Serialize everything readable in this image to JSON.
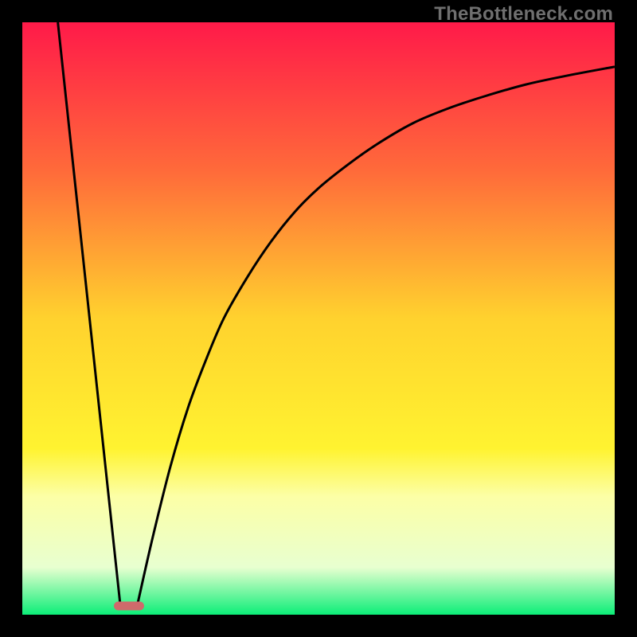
{
  "watermark": {
    "text": "TheBottleneck.com"
  },
  "chart_data": {
    "type": "line",
    "title": "",
    "xlabel": "",
    "ylabel": "",
    "xlim": [
      0,
      100
    ],
    "ylim": [
      0,
      100
    ],
    "gradient_stops": [
      {
        "at": 0,
        "color": "#ff1a49"
      },
      {
        "at": 25,
        "color": "#ff6a3a"
      },
      {
        "at": 50,
        "color": "#ffd22e"
      },
      {
        "at": 72,
        "color": "#fff330"
      },
      {
        "at": 80,
        "color": "#fcffa6"
      },
      {
        "at": 92,
        "color": "#e8ffd0"
      },
      {
        "at": 100,
        "color": "#0cee78"
      }
    ],
    "series": [
      {
        "name": "left-line",
        "x": [
          6.0,
          16.5
        ],
        "y": [
          100,
          2
        ]
      },
      {
        "name": "right-curve",
        "x": [
          19.5,
          22,
          25,
          28,
          31,
          34,
          38,
          42,
          46,
          50,
          55,
          60,
          66,
          72,
          78,
          85,
          92,
          100
        ],
        "y": [
          2,
          13,
          25,
          35,
          43,
          50,
          57,
          63,
          68,
          72,
          76,
          79.5,
          83,
          85.5,
          87.5,
          89.5,
          91,
          92.5
        ]
      }
    ],
    "marker": {
      "x": 18.0,
      "y": 1.5,
      "color": "#cf6a6b"
    }
  }
}
